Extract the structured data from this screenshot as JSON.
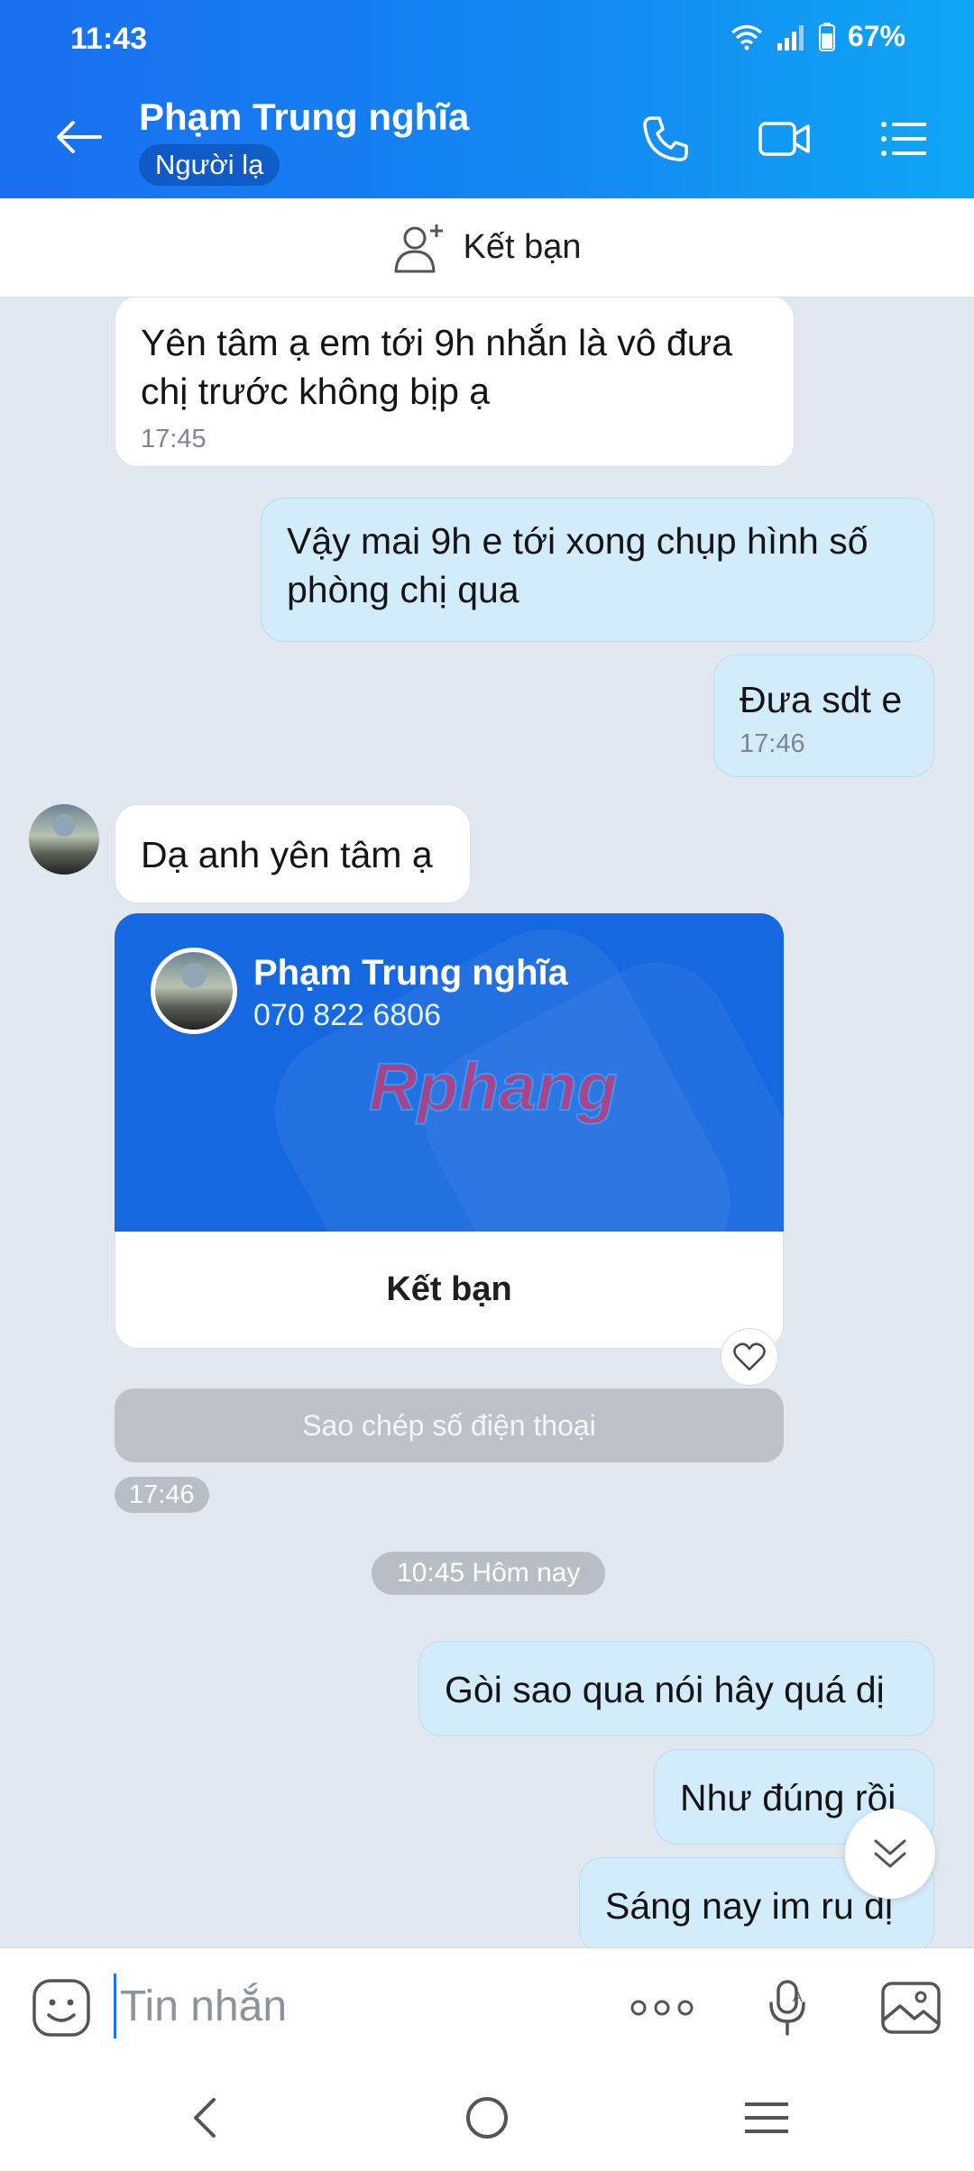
{
  "status": {
    "time": "11:43",
    "battery": "67%"
  },
  "header": {
    "name": "Phạm Trung nghĩa",
    "badge": "Người lạ"
  },
  "add_friend": {
    "label": "Kết bạn"
  },
  "messages": [
    {
      "side": "in",
      "text": "Yên tâm ạ em tới 9h nhắn là vô đưa chị trước không bịp ạ",
      "time": "17:45"
    },
    {
      "side": "out",
      "text": "Vậy mai 9h e tới xong chụp hình số phòng chị qua"
    },
    {
      "side": "out",
      "text": "Đưa sdt e",
      "time": "17:46"
    },
    {
      "side": "in",
      "text": "Dạ anh yên tâm ạ"
    },
    {
      "side": "out",
      "text": "Gòi sao qua nói hây quá dị"
    },
    {
      "side": "out",
      "text": "Như đúng rồi"
    },
    {
      "side": "out",
      "text": "Sáng nay im ru dị"
    }
  ],
  "contact_card": {
    "name": "Phạm Trung nghĩa",
    "phone": "070 822 6806",
    "watermark": "Rphang",
    "action": "Kết bạn",
    "copy_label": "Sao chép số điện thoại",
    "time": "17:46"
  },
  "date_divider": "10:45 Hôm nay",
  "input": {
    "placeholder": "Tin nhắn"
  },
  "icons": {
    "back": "arrow-left-icon",
    "call": "phone-icon",
    "video": "video-camera-icon",
    "menu": "list-menu-icon",
    "add_friend": "add-user-icon",
    "emoji": "emoji-icon",
    "more": "more-dots-icon",
    "voice": "microphone-icon",
    "image": "image-icon",
    "heart": "heart-icon",
    "scroll_down": "double-chevron-down-icon"
  },
  "colors": {
    "header_start": "#1a6ef0",
    "header_end": "#0fa6f5",
    "out_bubble": "#d3ecfc",
    "card_bg": "#1668e0"
  }
}
